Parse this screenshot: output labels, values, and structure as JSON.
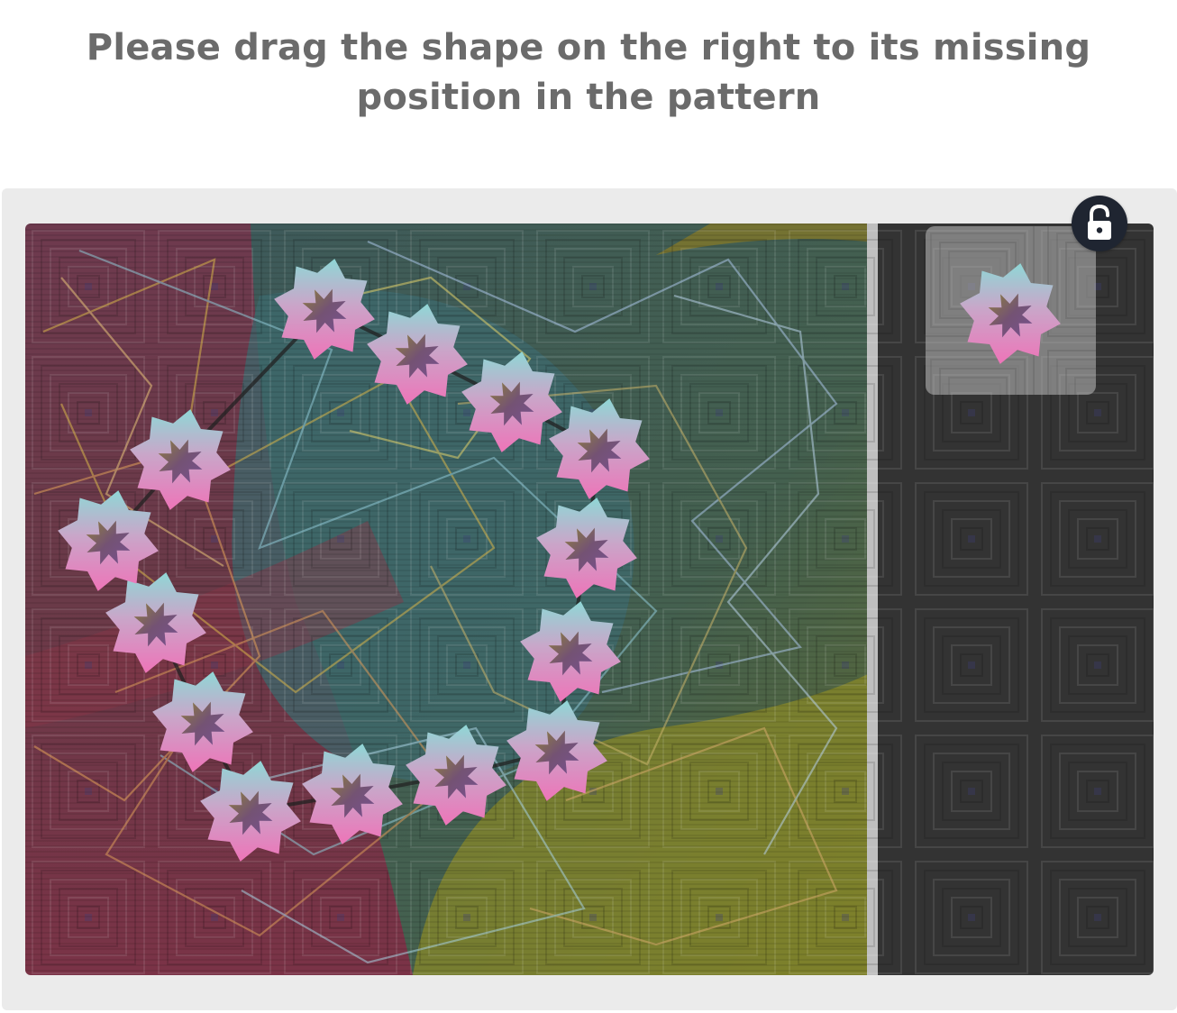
{
  "instruction": {
    "text": "Please drag the shape on the right to its missing position in the pattern"
  },
  "puzzle": {
    "shape": "eight-point-star",
    "shape_colors": {
      "outer_top": "#8fd3d6",
      "outer_bottom": "#e679b8",
      "inner": "#7a5a7a"
    },
    "background_colors": {
      "left": "#7a3348",
      "middle": "#3f5a55",
      "right_strip": "#333333",
      "accent_yellow": "#9a9020"
    },
    "pieces_in_pattern": 14,
    "draggable_piece_count": 1
  },
  "controls": {
    "lock_icon": "lock-open-icon",
    "lock_icon_color": "#ffffff",
    "lock_button_color": "#1f2531"
  }
}
